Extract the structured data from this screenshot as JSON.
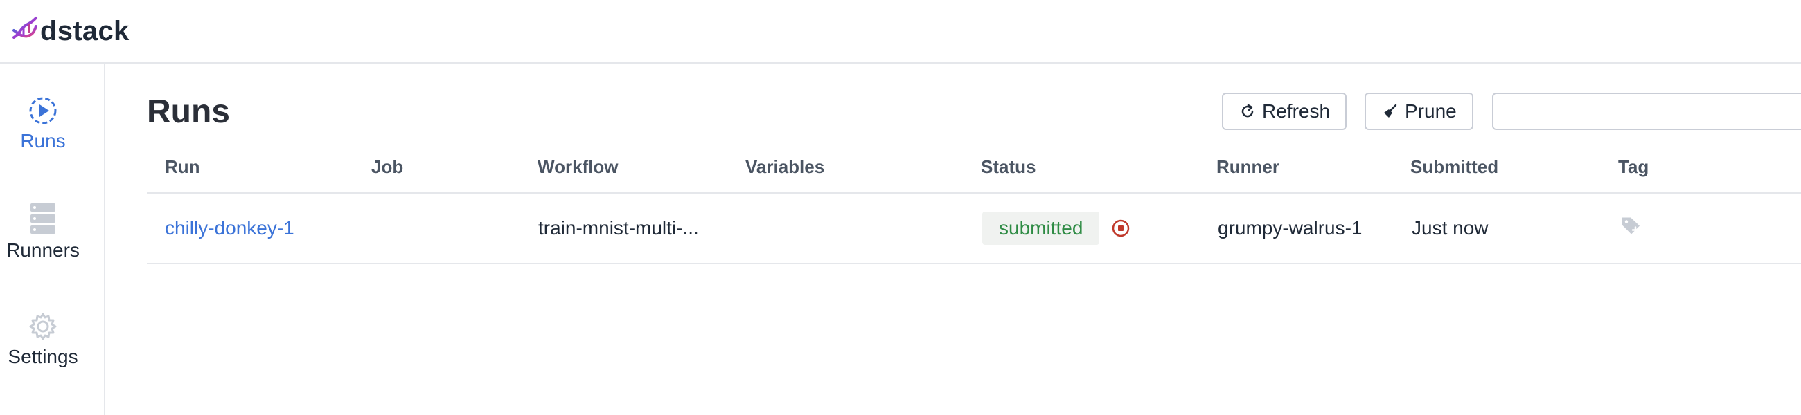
{
  "app": {
    "name": "dstack"
  },
  "sidebar": {
    "items": [
      {
        "label": "Runs",
        "icon": "play-circle-icon",
        "active": true
      },
      {
        "label": "Runners",
        "icon": "server-icon",
        "active": false
      },
      {
        "label": "Settings",
        "icon": "gear-icon",
        "active": false
      }
    ]
  },
  "main": {
    "title": "Runs",
    "toolbar": {
      "refresh_label": "Refresh",
      "prune_label": "Prune",
      "search_value": "",
      "search_placeholder": ""
    },
    "table": {
      "columns": [
        "Run",
        "Job",
        "Workflow",
        "Variables",
        "Status",
        "Runner",
        "Submitted",
        "Tag"
      ],
      "rows": [
        {
          "run": "chilly-donkey-1",
          "job": "",
          "workflow": "train-mnist-multi-...",
          "variables": "",
          "status": "submitted",
          "runner": "grumpy-walrus-1",
          "submitted": "Just now",
          "tag_icon": "tag-add-icon"
        }
      ]
    }
  },
  "colors": {
    "accent": "#3b73d8",
    "status_submitted_text": "#2e8b44",
    "status_submitted_bg": "#f0f2f0",
    "stop": "#c0392b",
    "border": "#e5e7eb"
  }
}
